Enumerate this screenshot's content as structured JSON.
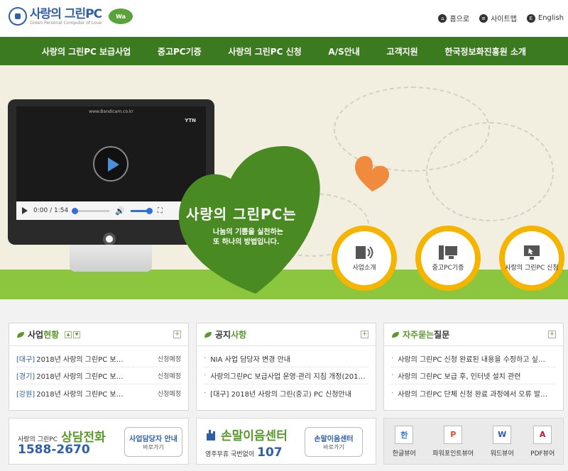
{
  "header": {
    "logo_title": "사랑의 그린PC",
    "logo_sub": "Green Personal Computer of Love",
    "logo_badge": "Wa",
    "util": [
      {
        "icon": "home-icon",
        "glyph": "⌂",
        "label": "홈으로"
      },
      {
        "icon": "sitemap-icon",
        "glyph": "≡",
        "label": "사이트맵"
      },
      {
        "icon": "english-icon",
        "glyph": "E",
        "label": "English"
      }
    ]
  },
  "nav": [
    "사랑의 그린PC 보급사업",
    "중고PC기증",
    "사랑의 그린PC 신청",
    "A/S안내",
    "고객지원",
    "한국정보화진흥원 소개"
  ],
  "hero": {
    "video": {
      "url_text": "www.Bandicam.co.kr",
      "channel": "YTN",
      "time": "0:00 / 1:54",
      "progress": 0.0
    },
    "heart_title": "사랑의 그린PC는",
    "heart_line1": "나눔의 기쁨을 실천하는",
    "heart_line2": "또 하나의 방법입니다.",
    "circles": [
      {
        "icon": "speaker-icon",
        "label": "사업소개"
      },
      {
        "icon": "computer-icon",
        "label": "중고PC기증"
      },
      {
        "icon": "monitor-cursor-icon",
        "label": "사랑의 그린PC 신청"
      }
    ],
    "colors": {
      "ground": "#8cc63f",
      "heart": "#4a8a22",
      "circle": "#f4b400",
      "orange_heart": "#f08a3c"
    }
  },
  "boards": {
    "status": {
      "title_a": "사업",
      "title_b": "현황",
      "more": "+",
      "rows": [
        {
          "tag": "[대구]",
          "title": "2018년 사랑의 그린PC 보…",
          "status": "신청예정"
        },
        {
          "tag": "[경기]",
          "title": "2018년 사랑의 그린PC 보…",
          "status": "신청예정"
        },
        {
          "tag": "[강원]",
          "title": "2018년 사랑의 그린PC 보…",
          "status": "신청예정"
        }
      ]
    },
    "notice": {
      "title_a": "공지",
      "title_b": "사항",
      "more": "+",
      "rows": [
        {
          "title": "NIA 사업 담당자 변경 안내"
        },
        {
          "title": "사랑의그린PC 보급사업 운영·관리 지침 개정(201…"
        },
        {
          "title": "[대구] 2018년 사랑의 그린(중고) PC 신청안내"
        }
      ]
    },
    "faq": {
      "title_a": "자주묻는",
      "title_b": "질문",
      "more": "+",
      "rows": [
        {
          "title": "사랑의 그린PC 신청 완료된 내용을 수정하고 싶…"
        },
        {
          "title": "사랑의 그린PC 보급 후, 인터넷 설치 관련"
        },
        {
          "title": "사랑의 그린PC 단체 신청 완료 과정에서 오류 발…"
        }
      ]
    }
  },
  "banners": {
    "phone": {
      "small": "사랑의 그린PC",
      "big": "상담전화",
      "number": "1588-2670",
      "btn_main": "사업담당자 안내",
      "btn_sub": "바로가기"
    },
    "sign": {
      "big": "손말이음센터",
      "small": "영주무휴 국번없이",
      "number": "107",
      "btn_main": "손말이음센터",
      "btn_sub": "바로가기"
    },
    "viewers": [
      {
        "icon": "hangul-viewer-icon",
        "glyph": "한",
        "color": "#2e7dd1",
        "label": "한글뷰어"
      },
      {
        "icon": "powerpoint-viewer-icon",
        "glyph": "P",
        "color": "#d2502b",
        "label": "파워포인트뷰어"
      },
      {
        "icon": "word-viewer-icon",
        "glyph": "W",
        "color": "#2a5bb0",
        "label": "워드뷰어"
      },
      {
        "icon": "pdf-viewer-icon",
        "glyph": "A",
        "color": "#c8102e",
        "label": "PDF뷰어"
      }
    ]
  }
}
